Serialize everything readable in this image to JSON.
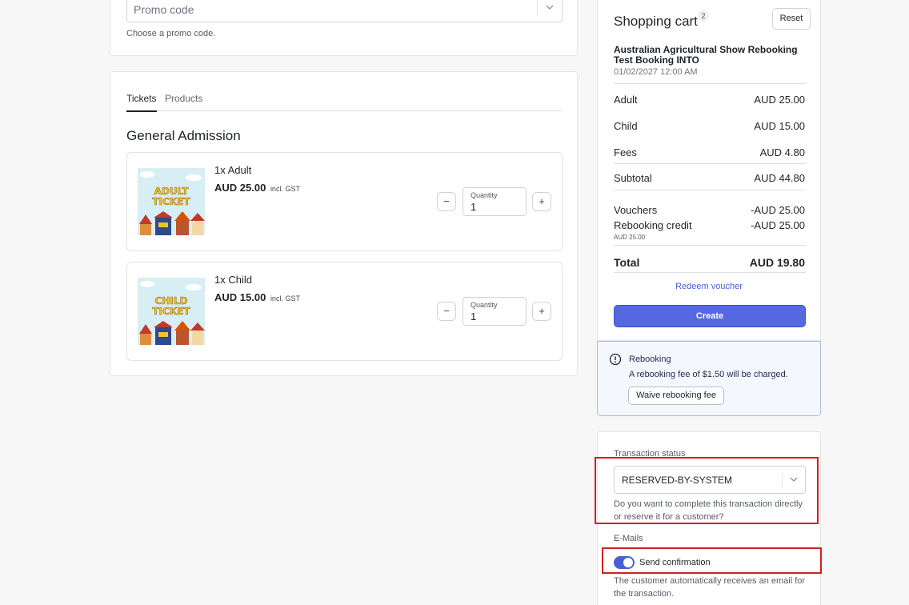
{
  "promo": {
    "placeholder": "Promo code",
    "help": "Choose a promo code."
  },
  "tabs": [
    {
      "label": "Tickets",
      "active": true
    },
    {
      "label": "Products",
      "active": false
    }
  ],
  "section_title": "General Admission",
  "tickets": [
    {
      "name": "1x Adult",
      "price": "AUD 25.00",
      "tax_note": "incl. GST",
      "image_text": [
        "ADULT",
        "TICKET"
      ],
      "qty_label": "Quantity",
      "qty": "1"
    },
    {
      "name": "1x Child",
      "price": "AUD 15.00",
      "tax_note": "incl. GST",
      "image_text": [
        "CHILD",
        "TICKET"
      ],
      "qty_label": "Quantity",
      "qty": "1"
    }
  ],
  "stepper": {
    "minus": "−",
    "plus": "+"
  },
  "cart": {
    "title": "Shopping cart",
    "count": "2",
    "reset": "Reset",
    "event_name": "Australian Agricultural Show Rebooking Test Booking INTO",
    "event_date": "01/02/2027 12:00 AM",
    "lines": [
      {
        "label": "Adult",
        "amount": "AUD 25.00"
      },
      {
        "label": "Child",
        "amount": "AUD 15.00"
      },
      {
        "label": "Fees",
        "amount": "AUD 4.80"
      },
      {
        "label": "Subtotal",
        "amount": "AUD 44.80"
      }
    ],
    "vouchers_label": "Vouchers",
    "vouchers_amount": "-AUD 25.00",
    "rebooking_label": "Rebooking credit",
    "rebooking_amount": "-AUD 25.00",
    "rebooking_sub": "AUD 25.00",
    "total_label": "Total",
    "total_amount": "AUD 19.80",
    "redeem": "Redeem voucher",
    "create": "Create"
  },
  "rebooking_notice": {
    "title": "Rebooking",
    "text": "A rebooking fee of $1.50 will be charged.",
    "waive": "Waive rebooking fee"
  },
  "transaction": {
    "status_label": "Transaction status",
    "status_value": "RESERVED-BY-SYSTEM",
    "status_help": "Do you want to complete this transaction directly or reserve it for a customer?",
    "emails_label": "E-Mails",
    "send_confirmation": "Send confirmation",
    "send_confirmation_on": true,
    "email_help": "The customer automatically receives an email for the transaction."
  },
  "colors": {
    "accent": "#5668e0",
    "highlight": "#d42020",
    "ticket_title": "#f2c12e"
  }
}
